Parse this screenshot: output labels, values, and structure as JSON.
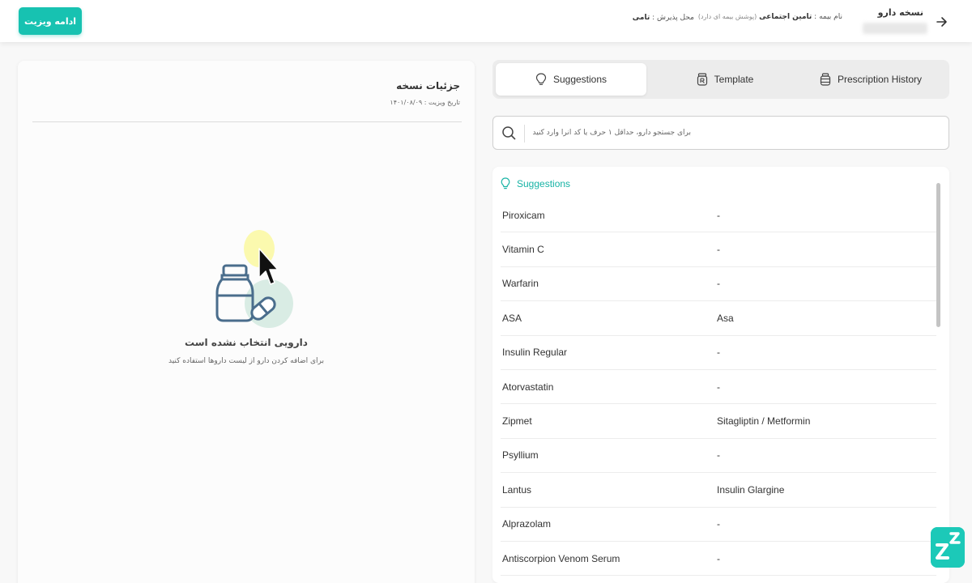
{
  "header": {
    "continue_button": "ادامه ویزیت",
    "prescription_title": "نسخه دارو",
    "insurance_label": "نام بیمه :",
    "insurance_value": "تامین اجتماعی",
    "insurance_note": "(پوشش بیمه ای دارد)",
    "admission_label": "محل پذیرش :",
    "admission_value": "تامی"
  },
  "details": {
    "title": "جزئیات نسخه",
    "visit_date": "تاریخ ویزیت : ۱۴۰۱/۰۸/۰۹",
    "empty_title": "دارویی انتخاب نشده است",
    "empty_subtitle": "برای اضافه کردن دارو از لیست داروها استفاده کنید"
  },
  "tabs": [
    {
      "label": "Suggestions",
      "icon": "lightbulb-icon",
      "active": true
    },
    {
      "label": "Template",
      "icon": "template-icon",
      "active": false
    },
    {
      "label": "Prescription History",
      "icon": "history-icon",
      "active": false
    }
  ],
  "search": {
    "placeholder": "برای جستجو دارو، حداقل ۱ حرف یا کد آنرا وارد کنید"
  },
  "suggestions": {
    "header": "Suggestions",
    "rows": [
      {
        "name": "Piroxicam",
        "generic": "-"
      },
      {
        "name": "Vitamin C",
        "generic": "-"
      },
      {
        "name": "Warfarin",
        "generic": "-"
      },
      {
        "name": "ASA",
        "generic": "Asa"
      },
      {
        "name": "Insulin Regular",
        "generic": "-"
      },
      {
        "name": "Atorvastatin",
        "generic": "-"
      },
      {
        "name": "Zipmet",
        "generic": "Sitagliptin / Metformin"
      },
      {
        "name": "Psyllium",
        "generic": "-"
      },
      {
        "name": "Lantus",
        "generic": "Insulin Glargine"
      },
      {
        "name": "Alprazolam",
        "generic": "-"
      },
      {
        "name": "Antiscorpion Venom Serum",
        "generic": "-"
      }
    ]
  },
  "colors": {
    "accent": "#17c2b1",
    "accent_text": "#17b3a5",
    "illustration_stroke": "#4a6d8c",
    "illustration_bg": "#d9ece4"
  }
}
